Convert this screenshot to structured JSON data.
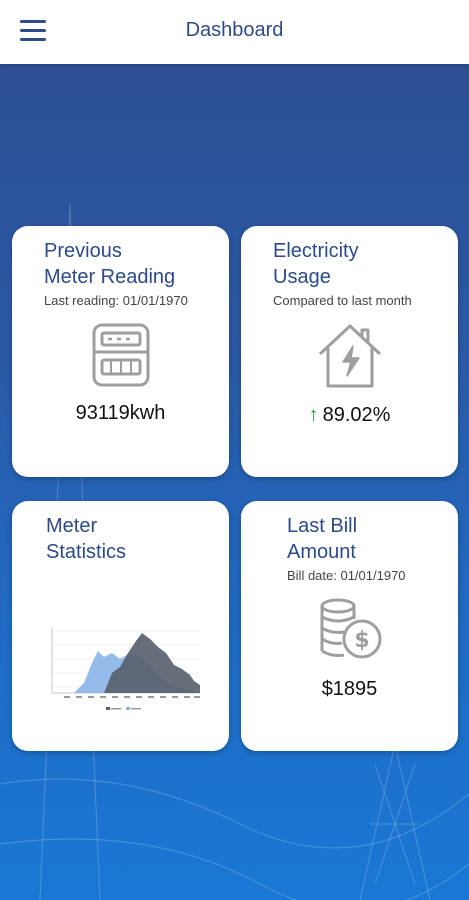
{
  "header": {
    "title": "Dashboard",
    "menu_icon": "hamburger-menu-icon"
  },
  "cards": {
    "previous_meter": {
      "title_line1": "Previous",
      "title_line2": "Meter Reading",
      "subtitle": "Last reading: 01/01/1970",
      "value": "93119kwh",
      "icon": "electric-meter-icon"
    },
    "electricity_usage": {
      "title_line1": "Electricity",
      "title_line2": "Usage",
      "subtitle": "Compared to last month",
      "value": "89.02%",
      "trend": "up",
      "icon": "house-lightning-icon"
    },
    "meter_statistics": {
      "title_line1": "Meter",
      "title_line2": "Statistics"
    },
    "last_bill": {
      "title_line1": "Last Bill",
      "title_line2": "Amount",
      "subtitle": "Bill date: 01/01/1970",
      "value": "$1895",
      "icon": "coins-dollar-icon"
    }
  },
  "colors": {
    "brand": "#2d4a8a",
    "trend_up": "#1f9a3a",
    "series_a": "#555e6a",
    "series_b": "#8ab4e8"
  }
}
